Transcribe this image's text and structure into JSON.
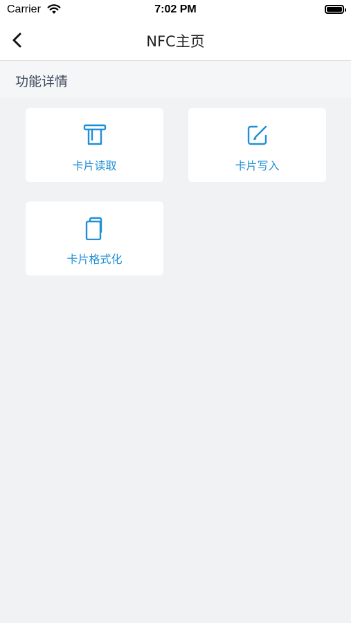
{
  "status_bar": {
    "carrier": "Carrier",
    "time": "7:02 PM"
  },
  "nav": {
    "title": "NFC主页",
    "back_icon": "chevron-left-icon"
  },
  "section": {
    "title": "功能详情"
  },
  "features": [
    {
      "label": "卡片读取",
      "icon": "card-reader-icon"
    },
    {
      "label": "卡片写入",
      "icon": "edit-icon"
    },
    {
      "label": "卡片格式化",
      "icon": "copy-icon"
    }
  ],
  "colors": {
    "accent": "#1f8fd6",
    "background": "#f0f2f4"
  }
}
